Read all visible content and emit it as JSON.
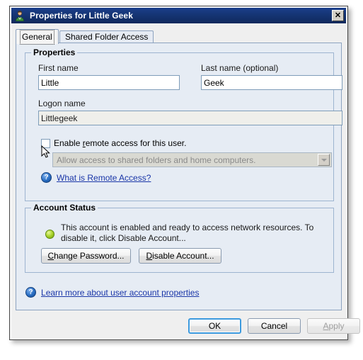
{
  "window": {
    "title": "Properties for Little Geek",
    "icon": "user-icon",
    "close_label": "✕"
  },
  "tabs": [
    {
      "label": "General",
      "active": true
    },
    {
      "label": "Shared Folder Access",
      "active": false
    }
  ],
  "properties_group": {
    "title": "Properties",
    "first_name": {
      "label": "First name",
      "value": "Little"
    },
    "last_name": {
      "label": "Last name (optional)",
      "value": "Geek"
    },
    "logon_name": {
      "label": "Logon name",
      "value": "Littlegeek",
      "disabled": true
    },
    "remote_access_checkbox": {
      "label_before": "Enable ",
      "accel": "r",
      "label_after": "emote access for this user.",
      "checked": false
    },
    "remote_access_combo": {
      "value": "Allow access to shared folders and home computers.",
      "disabled": true
    },
    "help_link": {
      "text_before": "W",
      "accel": "h",
      "text_after": "at is Remote Access?"
    }
  },
  "account_status_group": {
    "title": "Account Status",
    "status_icon": "enabled-indicator",
    "status_text": "This account is enabled and ready to access network resources. To disable it, click Disable Account...",
    "change_password_button": {
      "accel": "C",
      "rest": "hange Password..."
    },
    "disable_account_button": {
      "accel": "D",
      "rest": "isable Account..."
    }
  },
  "learn_more_link": {
    "accel": "L",
    "rest": "earn more about user account properties"
  },
  "footer_buttons": {
    "ok": "OK",
    "cancel": "Cancel",
    "apply": "Apply",
    "apply_disabled": true
  },
  "colors": {
    "titlebar_start": "#1b3f8b",
    "titlebar_end": "#10295c",
    "tabpage_bg": "#e6ecf4",
    "groupbox_border": "#9db4d0",
    "link": "#1a36a8",
    "status_green": "#a8d22a",
    "default_button_focus": "#3c9ade"
  }
}
